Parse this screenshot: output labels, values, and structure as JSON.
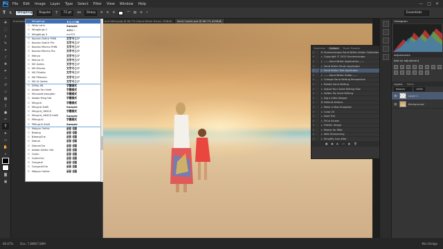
{
  "app": {
    "logo": "Ps",
    "menu": [
      "File",
      "Edit",
      "Image",
      "Layer",
      "Type",
      "Select",
      "Filter",
      "View",
      "Window",
      "Help"
    ],
    "window_controls": [
      "—",
      "□",
      "✕"
    ]
  },
  "options": {
    "font_family": "Wingdings",
    "font_style": "Regular",
    "font_size": "72 pt",
    "antialias": "Sharp",
    "workspace": "Essentials"
  },
  "tabs": [
    "Summerscape.jpg",
    "Sand Writer Brush and Action Collection before and After.jpeg @ 66.7% (Sand Writer Brush, RGB/8)",
    "Sand Castle.psd @ 66.7% (RGB/8)"
  ],
  "font_list": {
    "groups": [
      [
        {
          "name": "Wingdings",
          "sample": "♦☺✈✉☎",
          "selected": true
        },
        {
          "name": "Wide Latin",
          "sample": "Sample"
        },
        {
          "name": "Wingdings 2",
          "sample": "★✠✡☆"
        },
        {
          "name": "Wingdings 3",
          "sample": "⇦⇨⇧⇩"
        }
      ],
      [
        {
          "name": "Kozuka Gothic Pr6N",
          "sample": "文字モじジ"
        },
        {
          "name": "Kozuka Gothic Pro",
          "sample": "文字モじジ"
        },
        {
          "name": "Kozuka Mincho Pr6N",
          "sample": "文字モじジ"
        },
        {
          "name": "Kozuka Mincho Pro",
          "sample": "文字モじジ"
        },
        {
          "name": "Meiryo",
          "sample": "文字モじジ"
        },
        {
          "name": "Meiryo UI",
          "sample": "文字モじジ"
        },
        {
          "name": "MS Gothic",
          "sample": "文字モじジ"
        },
        {
          "name": "MS Mincho",
          "sample": "文字モじジ"
        },
        {
          "name": "MS PGothic",
          "sample": "文字モじジ"
        },
        {
          "name": "MS PMincho",
          "sample": "文字モじジ"
        },
        {
          "name": "MS UI Gothic",
          "sample": "文字モじジ"
        }
      ],
      [
        {
          "name": "DFKai-SB",
          "sample": "字體樣式"
        },
        {
          "name": "Adobe Fan Heiti",
          "sample": "字體樣式"
        },
        {
          "name": "Microsoft JhengHei",
          "sample": "字體樣式"
        },
        {
          "name": "Adobe Ming Std",
          "sample": "字體樣式"
        },
        {
          "name": "MingLiU",
          "sample": "字體樣式"
        },
        {
          "name": "MingLiU-ExtB",
          "sample": "Sample"
        },
        {
          "name": "MingLiU_HKSCS",
          "sample": "字體樣式"
        },
        {
          "name": "MingLiU_HKSCS-ExtB",
          "sample": "Sample"
        },
        {
          "name": "PMingLiU",
          "sample": "字體樣式"
        },
        {
          "name": "PMingLiU-ExtB",
          "sample": "Sample"
        }
      ],
      [
        {
          "name": "Malgun Gothic",
          "sample": "글꼴 샘플"
        },
        {
          "name": "Batang",
          "sample": "글꼴 샘플"
        },
        {
          "name": "BatangChe",
          "sample": "글꼴 샘플"
        },
        {
          "name": "Dotum",
          "sample": "글꼴 샘플"
        },
        {
          "name": "DotumChe",
          "sample": "글꼴 샘플"
        },
        {
          "name": "Adobe Gothic Std",
          "sample": "글꼴 샘플"
        },
        {
          "name": "Gulim",
          "sample": "글꼴 샘플"
        },
        {
          "name": "GulimChe",
          "sample": "글꼴 샘플"
        },
        {
          "name": "Gungsuh",
          "sample": "글꼴 샘플"
        },
        {
          "name": "GungsuhChe",
          "sample": "글꼴 샘플"
        },
        {
          "name": "Malgun Gothic",
          "sample": "글꼴 샘플"
        }
      ]
    ]
  },
  "actions_panel": {
    "tabs": [
      "Swatches",
      "Actions",
      "Brush Presets"
    ],
    "active_tab": "Actions",
    "rows": [
      {
        "label": "Summerscape Sand Writer Action Collection",
        "tri": "▼"
      },
      {
        "label": "Copyright © 2013 Summerscape",
        "tri": "▸"
      },
      {
        "label": "------Sand Writer Application------",
        "tri": "▸"
      },
      {
        "label": "Sand Writer Brush Applicator",
        "tri": "▸"
      },
      {
        "label": "Sand Writer Text Applicator",
        "tri": "▸",
        "selected": true
      },
      {
        "label": "------Sand Writer Editor------",
        "tri": "▸"
      },
      {
        "label": "Change Sand Writing Perspective",
        "tri": "▸"
      },
      {
        "label": "Rotate Sand Writing",
        "tri": "▸"
      },
      {
        "label": "Adjust Your Sand Writing Size",
        "tri": "▸"
      },
      {
        "label": "Soften My Sand Writing",
        "tri": "▸"
      },
      {
        "label": "Dig a Little Deeper",
        "tri": "▸"
      },
      {
        "label": "Default Actions",
        "tri": "▼"
      },
      {
        "label": "Make a New Snapshot",
        "tri": "▸"
      },
      {
        "label": "Color 25",
        "tri": "▸"
      },
      {
        "label": "Dark Pull",
        "tri": "▸"
      },
      {
        "label": "Fit to Screen",
        "tri": "▸"
      },
      {
        "label": "Flatten Image",
        "tri": "▸"
      },
      {
        "label": "Resize for Web",
        "tri": "▸"
      },
      {
        "label": "Web Sharpening",
        "tri": "▸"
      },
      {
        "label": "Simplify Icon after",
        "tri": "▸"
      }
    ],
    "footer_icons": [
      "■",
      "●",
      "▶",
      "▭",
      "▣",
      "🗑"
    ]
  },
  "right_panels": {
    "histogram_title": "Histogram",
    "adjustments_title": "Adjustments",
    "add_adjustment": "Add an adjustment",
    "layers_tabs": [
      "Layers",
      "Paths"
    ],
    "blend_mode": "Normal",
    "opacity": "100%",
    "layers": [
      {
        "name": "Layer 1",
        "selected": true
      },
      {
        "name": "Background",
        "selected": false
      }
    ]
  },
  "status": {
    "zoom": "66.67%",
    "doc_size": "Doc: 7.88M/7.88M",
    "mini_bridge": "Mini Bridge"
  },
  "colors": {
    "accent": "#3b6fb6",
    "panel": "#353535"
  }
}
